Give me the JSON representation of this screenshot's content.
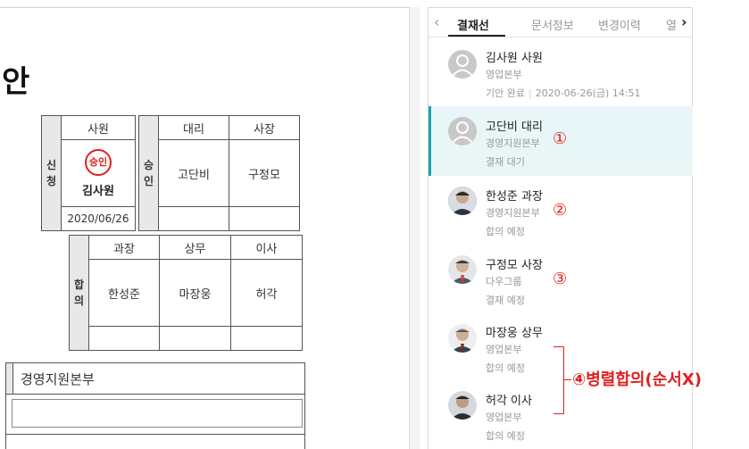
{
  "document": {
    "title": "안",
    "application_label": "신청",
    "approval_label": "승인",
    "agreement_label": "합의",
    "applicant": {
      "rank": "사원",
      "stamp_text": "승인",
      "name": "김사원",
      "date": "2020/06/26"
    },
    "approvers": [
      {
        "rank": "대리",
        "name": "고단비"
      },
      {
        "rank": "사장",
        "name": "구정모"
      }
    ],
    "agreement": [
      {
        "rank": "과장",
        "name": "한성준"
      },
      {
        "rank": "상무",
        "name": "마장웅"
      },
      {
        "rank": "이사",
        "name": "허각"
      }
    ],
    "department": "경영지원본부"
  },
  "panel": {
    "tabs": [
      "결재선",
      "문서정보",
      "변경이력",
      "열"
    ],
    "active_tab": "결재선",
    "prev_icon": "chevron-left-icon",
    "next_icon": "chevron-right-icon",
    "items": [
      {
        "name": "김사원 사원",
        "dept": "영업본부",
        "status": "기안 완료",
        "datetime": "2020-06-26(금) 14:51",
        "avatar": "default-user-icon"
      },
      {
        "name": "고단비 대리",
        "dept": "경영지원본부",
        "status": "결재 대기",
        "avatar": "default-user-icon",
        "marker": "①"
      },
      {
        "name": "한성준 과장",
        "dept": "경영지원본부",
        "status": "합의 예정",
        "avatar": "photo",
        "marker": "②"
      },
      {
        "name": "구정모 사장",
        "dept": "다우그룹",
        "status": "결재 예정",
        "avatar": "photo",
        "marker": "③"
      },
      {
        "name": "마장웅 상무",
        "dept": "영업본부",
        "status": "합의 예정",
        "avatar": "photo"
      },
      {
        "name": "허각 이사",
        "dept": "영업본부",
        "status": "합의 예정",
        "avatar": "photo"
      }
    ]
  },
  "annotation": {
    "marker": "④",
    "text": "병렬합의(순서X)",
    "color": "#e02020"
  },
  "colors": {
    "accent": "#1aa3ad",
    "active_row": "#e9f6f7",
    "stamp": "#e02020"
  }
}
